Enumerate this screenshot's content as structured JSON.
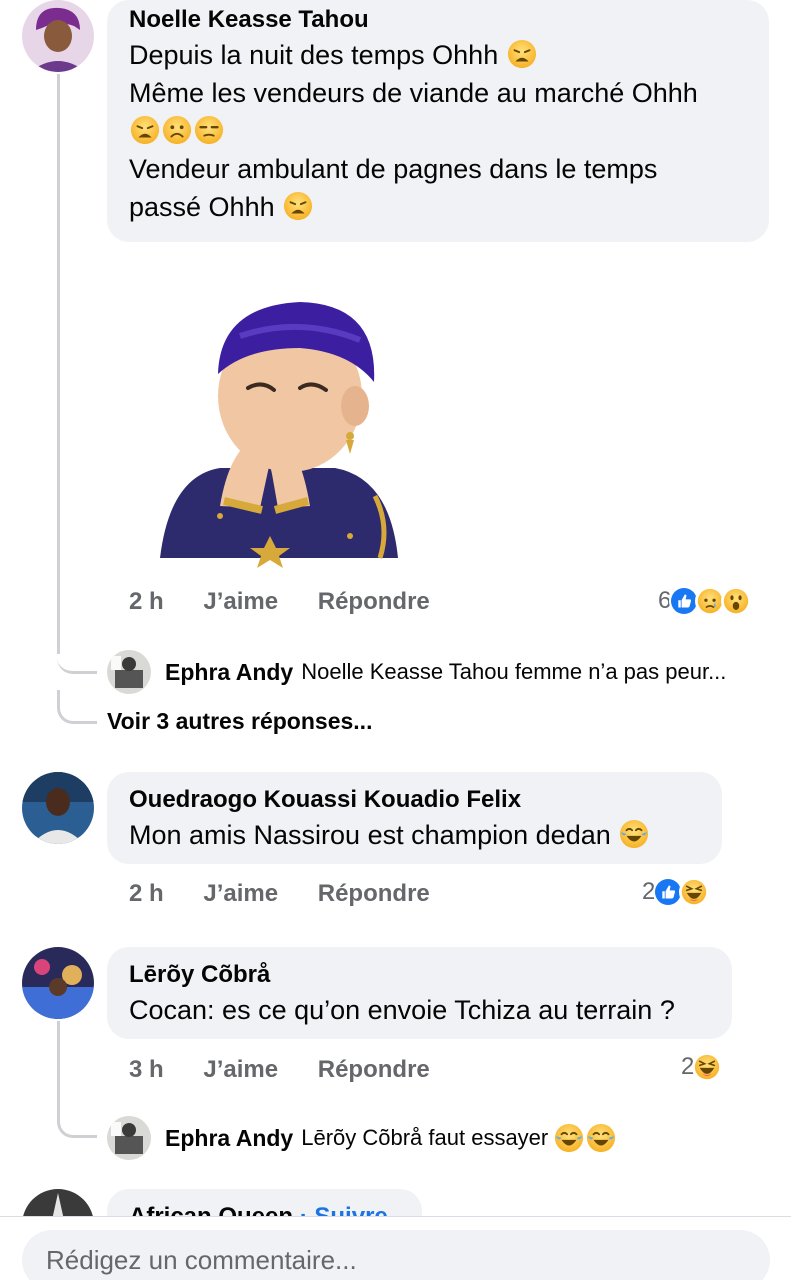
{
  "comments": [
    {
      "author": "Noelle Keasse Tahou",
      "lines": [
        "Depuis la nuit des temps Ohhh",
        "Même les vendeurs de viande au marché Ohhh",
        "Vendeur ambulant de pagnes dans le temps",
        "passé Ohhh"
      ],
      "sticker": "laughing-avatar-sticker",
      "time": "2 h",
      "like": "J’aime",
      "reply": "Répondre",
      "reaction_count": "6",
      "reactions": [
        "like",
        "sad",
        "wow"
      ],
      "replies": [
        {
          "author": "Ephra Andy",
          "text": "Noelle Keasse Tahou femme n’a pas peur..."
        }
      ],
      "more_replies": "Voir 3 autres réponses..."
    },
    {
      "author": "Ouedraogo Kouassi Kouadio Felix",
      "text": "Mon amis Nassirou est champion dedan",
      "time": "2 h",
      "like": "J’aime",
      "reply": "Répondre",
      "reaction_count": "2",
      "reactions": [
        "like",
        "haha"
      ]
    },
    {
      "author": "Lērõy Cõbrå",
      "text": "Cocan: es ce qu’on envoie Tchiza au terrain ?",
      "time": "3 h",
      "like": "J’aime",
      "reply": "Répondre",
      "reaction_count": "2",
      "reactions": [
        "haha"
      ],
      "replies": [
        {
          "author": "Ephra Andy",
          "text": "Lērõy Cõbrå faut essayer"
        }
      ]
    },
    {
      "author": "African Queen",
      "follow": "· Suivre"
    }
  ],
  "composer": {
    "placeholder": "Rédigez un commentaire..."
  },
  "colors": {
    "bubble": "#f0f2f5",
    "meta": "#65676b",
    "link": "#1b74e4",
    "like": "#1877f2",
    "emoji": "#f7b125"
  }
}
